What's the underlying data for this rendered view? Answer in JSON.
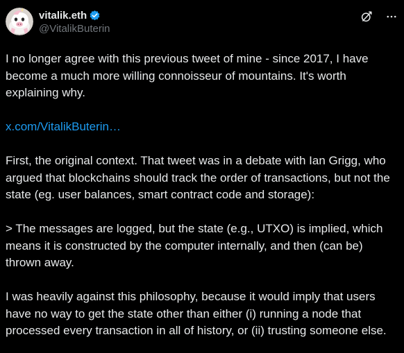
{
  "author": {
    "display_name": "vitalik.eth",
    "handle": "@VitalikButerin",
    "verified_icon": "verified-badge-icon",
    "avatar_icon": "avatar-unicorn-icon"
  },
  "actions": {
    "grok_icon": "grok-icon",
    "more_icon": "more-icon"
  },
  "tweet": {
    "p1": "I no longer agree with this previous tweet of mine - since 2017, I have become a much more willing connoisseur of mountains. It's worth explaining why.",
    "link": "x.com/VitalikButerin…",
    "p2": "First, the original context. That tweet was in a debate with Ian Grigg, who argued that blockchains should track the order of transactions, but not the state (eg. user balances, smart contract code and storage):",
    "p3": "> The messages are logged, but the state (e.g., UTXO) is implied, which means it is constructed by the computer internally, and then (can be) thrown away.",
    "p4": "I was heavily against this philosophy, because it would imply that users have no way to get the state other than either (i) running a node that processed every transaction in all of history, or (ii) trusting someone else."
  },
  "colors": {
    "background": "#000000",
    "text": "#e7e9ea",
    "secondary": "#71767b",
    "link": "#1d9bf0",
    "verified": "#1d9bf0"
  }
}
